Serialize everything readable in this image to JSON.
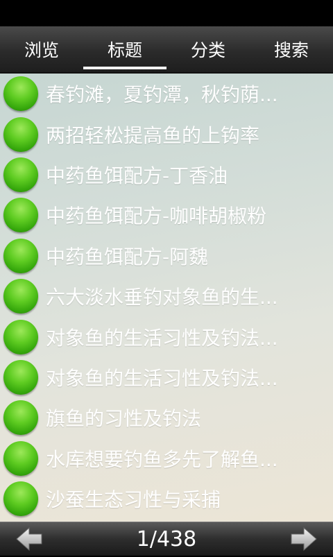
{
  "tabs": [
    {
      "label": "浏览"
    },
    {
      "label": "标题"
    },
    {
      "label": "分类"
    },
    {
      "label": "搜索"
    }
  ],
  "active_tab": "标题",
  "items": [
    {
      "title": "春钓滩，夏钓潭，秋钓荫..."
    },
    {
      "title": "两招轻松提高鱼的上钩率"
    },
    {
      "title": "中药鱼饵配方-丁香油"
    },
    {
      "title": "中药鱼饵配方-咖啡胡椒粉"
    },
    {
      "title": "中药鱼饵配方-阿魏"
    },
    {
      "title": "六大淡水垂钓对象鱼的生..."
    },
    {
      "title": "对象鱼的生活习性及钓法..."
    },
    {
      "title": "对象鱼的生活习性及钓法..."
    },
    {
      "title": "旗鱼的习性及钓法"
    },
    {
      "title": "水库想要钓鱼多先了解鱼..."
    },
    {
      "title": "沙蚕生态习性与采捕"
    }
  ],
  "pagination": {
    "text": "1/438"
  },
  "icons": {
    "prev": "arrow-left-icon",
    "next": "arrow-right-icon",
    "bullet": "green-ball-icon"
  }
}
